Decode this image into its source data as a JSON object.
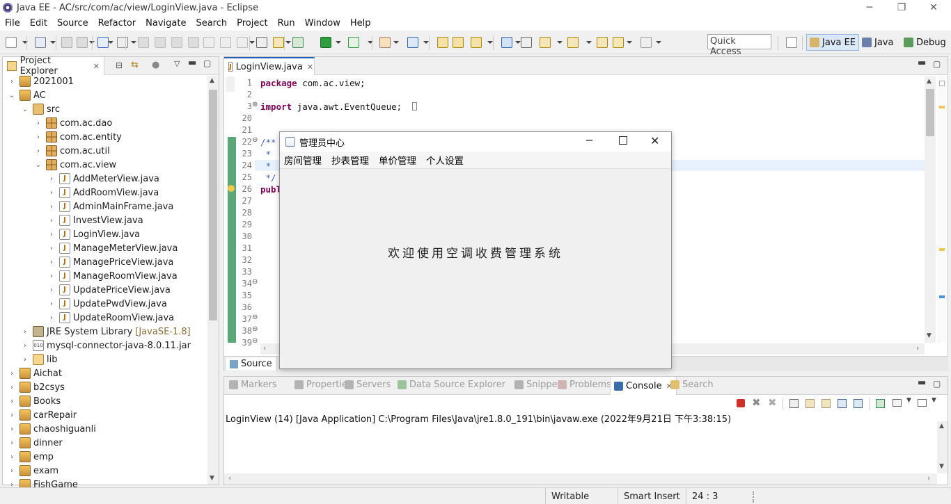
{
  "window": {
    "title": "Java EE - AC/src/com/ac/view/LoginView.java - Eclipse",
    "controls": {
      "minimize": "─",
      "restore": "❐",
      "close": "✕"
    }
  },
  "menubar": [
    "File",
    "Edit",
    "Source",
    "Refactor",
    "Navigate",
    "Search",
    "Project",
    "Run",
    "Window",
    "Help"
  ],
  "toolbar": {
    "quick_access": "Quick Access",
    "perspectives": [
      {
        "label": "Java EE",
        "icon": "javaee-perspective-icon",
        "active": true
      },
      {
        "label": "Java",
        "icon": "java-perspective-icon",
        "active": false
      },
      {
        "label": "Debug",
        "icon": "debug-perspective-icon",
        "active": false
      }
    ]
  },
  "project_explorer": {
    "title": "Project Explorer",
    "rows": [
      {
        "label": "2021001",
        "icon": "project",
        "level": 0,
        "chevron": "›"
      },
      {
        "label": "AC",
        "icon": "project",
        "level": 0,
        "chevron": "⌄"
      },
      {
        "label": "src",
        "icon": "src",
        "level": 1,
        "chevron": "⌄"
      },
      {
        "label": "com.ac.dao",
        "icon": "pkg",
        "level": 2,
        "chevron": "›"
      },
      {
        "label": "com.ac.entity",
        "icon": "pkg",
        "level": 2,
        "chevron": "›"
      },
      {
        "label": "com.ac.util",
        "icon": "pkg",
        "level": 2,
        "chevron": "›"
      },
      {
        "label": "com.ac.view",
        "icon": "pkg",
        "level": 2,
        "chevron": "⌄"
      },
      {
        "label": "AddMeterView.java",
        "icon": "java",
        "level": 3,
        "chevron": "›"
      },
      {
        "label": "AddRoomView.java",
        "icon": "java",
        "level": 3,
        "chevron": "›"
      },
      {
        "label": "AdminMainFrame.java",
        "icon": "java",
        "level": 3,
        "chevron": "›"
      },
      {
        "label": "InvestView.java",
        "icon": "java",
        "level": 3,
        "chevron": "›"
      },
      {
        "label": "LoginView.java",
        "icon": "java",
        "level": 3,
        "chevron": "›"
      },
      {
        "label": "ManageMeterView.java",
        "icon": "java",
        "level": 3,
        "chevron": "›"
      },
      {
        "label": "ManagePriceView.java",
        "icon": "java",
        "level": 3,
        "chevron": "›"
      },
      {
        "label": "ManageRoomView.java",
        "icon": "java",
        "level": 3,
        "chevron": "›"
      },
      {
        "label": "UpdatePriceView.java",
        "icon": "java",
        "level": 3,
        "chevron": "›"
      },
      {
        "label": "UpdatePwdView.java",
        "icon": "java",
        "level": 3,
        "chevron": "›"
      },
      {
        "label": "UpdateRoomView.java",
        "icon": "java",
        "level": 3,
        "chevron": "›"
      },
      {
        "label": "JRE System Library",
        "suffix": "[JavaSE-1.8]",
        "icon": "lib",
        "level": 1,
        "chevron": "›"
      },
      {
        "label": "mysql-connector-java-8.0.11.jar",
        "icon": "jar",
        "level": 1,
        "chevron": "›"
      },
      {
        "label": "lib",
        "icon": "folder",
        "level": 1,
        "chevron": "›"
      },
      {
        "label": "Aichat",
        "icon": "project",
        "level": 0,
        "chevron": "›"
      },
      {
        "label": "b2csys",
        "icon": "project",
        "level": 0,
        "chevron": "›"
      },
      {
        "label": "Books",
        "icon": "project",
        "level": 0,
        "chevron": "›"
      },
      {
        "label": "carRepair",
        "icon": "project",
        "level": 0,
        "chevron": "›"
      },
      {
        "label": "chaoshiguanli",
        "icon": "project",
        "level": 0,
        "chevron": "›"
      },
      {
        "label": "dinner",
        "icon": "project",
        "level": 0,
        "chevron": "›"
      },
      {
        "label": "emp",
        "icon": "project",
        "level": 0,
        "chevron": "›"
      },
      {
        "label": "exam",
        "icon": "project",
        "level": 0,
        "chevron": "›"
      },
      {
        "label": "FishGame",
        "icon": "project",
        "level": 0,
        "chevron": "›"
      }
    ]
  },
  "editor": {
    "tab": "LoginView.java",
    "lines": [
      {
        "n": "1",
        "kw": "package",
        "text": " com.ac.view;"
      },
      {
        "n": "2",
        "kw": "",
        "text": ""
      },
      {
        "n": "3",
        "kw": "import",
        "text": " java.awt.EventQueue;",
        "fold": "⊕"
      },
      {
        "n": "20",
        "kw": "",
        "text": ""
      },
      {
        "n": "21",
        "kw": "",
        "text": ""
      },
      {
        "n": "22",
        "kw": "",
        "text": "/**",
        "fold": "⊖",
        "comment": true
      },
      {
        "n": "23",
        "kw": "",
        "text": " * ",
        "comment": true
      },
      {
        "n": "24",
        "kw": "",
        "text": " * ",
        "comment": true
      },
      {
        "n": "25",
        "kw": "",
        "text": " */",
        "comment": true
      },
      {
        "n": "26",
        "kw": "publ",
        "text": ""
      },
      {
        "n": "27",
        "kw": "",
        "text": ""
      },
      {
        "n": "28",
        "kw": "",
        "text": ""
      },
      {
        "n": "29",
        "kw": "",
        "text": ""
      },
      {
        "n": "30",
        "kw": "",
        "text": ""
      },
      {
        "n": "31",
        "kw": "",
        "text": ""
      },
      {
        "n": "32",
        "kw": "",
        "text": ""
      },
      {
        "n": "33",
        "kw": "",
        "text": ""
      },
      {
        "n": "34",
        "kw": "",
        "text": "",
        "fold": "⊖"
      },
      {
        "n": "35",
        "kw": "",
        "text": ""
      },
      {
        "n": "36",
        "kw": "",
        "text": ""
      },
      {
        "n": "37",
        "kw": "",
        "text": "",
        "fold": "⊖"
      },
      {
        "n": "38",
        "kw": "",
        "text": "",
        "fold": "⊖"
      },
      {
        "n": "39",
        "kw": "",
        "text": "",
        "fold": "⊖"
      }
    ],
    "bottom_tabs": {
      "source": "Source"
    }
  },
  "bottom_panel": {
    "tabs": [
      {
        "label": "Markers",
        "icon": "markers-icon"
      },
      {
        "label": "Properties",
        "icon": "properties-icon"
      },
      {
        "label": "Servers",
        "icon": "servers-icon"
      },
      {
        "label": "Data Source Explorer",
        "icon": "datasource-icon"
      },
      {
        "label": "Snippets",
        "icon": "snippets-icon"
      },
      {
        "label": "Problems",
        "icon": "problems-icon"
      },
      {
        "label": "Console",
        "icon": "console-icon",
        "active": true
      },
      {
        "label": "Search",
        "icon": "search-icon"
      }
    ],
    "console_line": "LoginView (14) [Java Application] C:\\Program Files\\Java\\jre1.8.0_191\\bin\\javaw.exe (2022年9月21日 下午3:38:15)"
  },
  "statusbar": {
    "writable": "Writable",
    "insert_mode": "Smart Insert",
    "position": "24 : 3"
  },
  "dialog": {
    "title": "管理员中心",
    "menus": [
      "房间管理",
      "抄表管理",
      "单价管理",
      "个人设置"
    ],
    "welcome": "欢迎使用空调收费管理系统"
  },
  "colors": {
    "accent": "#1f5fb2",
    "keyword": "#7f0055",
    "comment": "#3f5fbf",
    "terminate": "#d0302a"
  }
}
